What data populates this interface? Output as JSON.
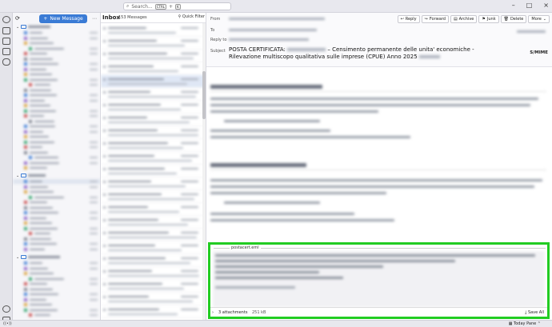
{
  "titlebar": {
    "search_placeholder": "Search...",
    "shortcut_mod": "CTRL",
    "shortcut_plus": "+",
    "shortcut_key": "K",
    "minimize": "–",
    "maximize": "□",
    "close": "×"
  },
  "folders": {
    "new_message": "New Message",
    "accounts": [
      "",
      "",
      ""
    ]
  },
  "list": {
    "title": "Inbox",
    "count": "153 Messages",
    "quick_filter": "Quick Filter"
  },
  "message": {
    "from_label": "From",
    "to_label": "To",
    "replyto_label": "Reply to",
    "subject_label": "Subject",
    "subject_prefix": "POSTA CERTIFICATA:",
    "subject_text": "– Censimento permanente delle unita' economiche - Rilevazione multiscopo qualitativa sulle imprese (CPUE) Anno 2025",
    "smime": "S/MIME",
    "toolbar": {
      "reply": "Reply",
      "forward": "Forward",
      "archive": "Archive",
      "junk": "Junk",
      "delete": "Delete",
      "more": "More"
    }
  },
  "attachment": {
    "filename": "postacert.eml",
    "count": "3 attachments",
    "size": "251 kB",
    "save_all": "Save All"
  },
  "status": {
    "today_pane": "Today Pane"
  },
  "colors": {
    "accent": "#3a7bd5",
    "highlight": "#22cc22"
  }
}
